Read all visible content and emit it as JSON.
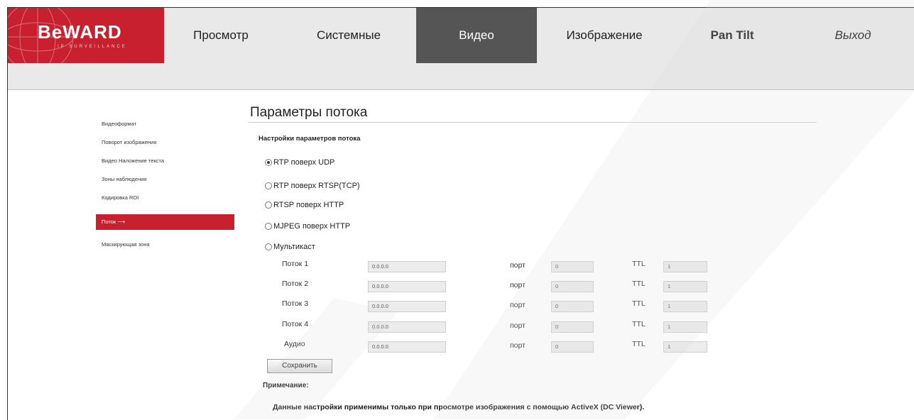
{
  "brand": {
    "name": "BeWARD",
    "tagline": "IP SURVEILLANCE"
  },
  "nav": {
    "tabs": [
      {
        "label": "Просмотр"
      },
      {
        "label": "Системные"
      },
      {
        "label": "Видео",
        "active": true
      },
      {
        "label": "Изображение"
      },
      {
        "label": "Pan Tilt"
      },
      {
        "label": "Выход"
      }
    ]
  },
  "sidebar": {
    "items": [
      {
        "label": "Видеоформат"
      },
      {
        "label": "Поворот изображения"
      },
      {
        "label": "Видео Наложение текста"
      },
      {
        "label": "Зоны наблюдения"
      },
      {
        "label": "Кодировка ROI"
      },
      {
        "label": "Поток",
        "active": true
      },
      {
        "label": "Маскирующая зона"
      }
    ]
  },
  "main": {
    "title": "Параметры потока",
    "section_label": "Настройки параметров потока",
    "options": [
      {
        "label": "RTP поверх UDP",
        "checked": true
      },
      {
        "label": "RTP поверх RTSP(TCP)"
      },
      {
        "label": "RTSP поверх HTTP"
      },
      {
        "label": "MJPEG поверх HTTP"
      },
      {
        "label": "Мультикаст"
      }
    ],
    "port_label": "порт",
    "ttl_label": "TTL",
    "streams": [
      {
        "name": "Поток 1",
        "ip": "0.0.0.0",
        "port": "0",
        "ttl": "1"
      },
      {
        "name": "Поток 2",
        "ip": "0.0.0.0",
        "port": "0",
        "ttl": "1"
      },
      {
        "name": "Поток 3",
        "ip": "0.0.0.0",
        "port": "0",
        "ttl": "1"
      },
      {
        "name": "Поток 4",
        "ip": "0.0.0.0",
        "port": "0",
        "ttl": "1"
      },
      {
        "name": "Аудио",
        "ip": "0.0.0.0",
        "port": "0",
        "ttl": "1"
      }
    ],
    "save_label": "Сохранить",
    "note_label": "Примечание:",
    "note_text": "Данные настройки применимы только при просмотре изображения с помощью ActiveX (DC Viewer)."
  },
  "colors": {
    "brand_red": "#c8202f",
    "active_tab": "#555555",
    "watermark": "#f0f0f0"
  }
}
